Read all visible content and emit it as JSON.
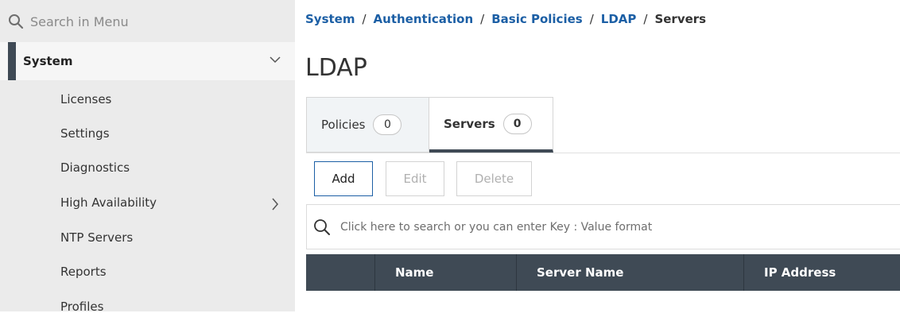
{
  "sidebar": {
    "search_placeholder": "Search in Menu",
    "section_label": "System",
    "items": [
      {
        "label": "Licenses"
      },
      {
        "label": "Settings"
      },
      {
        "label": "Diagnostics"
      },
      {
        "label": "High Availability",
        "has_submenu": true
      },
      {
        "label": "NTP Servers"
      },
      {
        "label": "Reports"
      },
      {
        "label": "Profiles"
      }
    ]
  },
  "breadcrumb": {
    "items": [
      "System",
      "Authentication",
      "Basic Policies",
      "LDAP"
    ],
    "current": "Servers",
    "separator": "/"
  },
  "page": {
    "title": "LDAP"
  },
  "tabs": [
    {
      "label": "Policies",
      "count": "0",
      "active": false
    },
    {
      "label": "Servers",
      "count": "0",
      "active": true
    }
  ],
  "toolbar": {
    "add_label": "Add",
    "edit_label": "Edit",
    "delete_label": "Delete"
  },
  "table": {
    "search_placeholder": "Click here to search or you can enter Key : Value format",
    "columns": [
      "Name",
      "Server Name",
      "IP Address"
    ]
  },
  "colors": {
    "accent": "#1c5fa5",
    "header_bg": "#3f4a55",
    "sidebar_bg": "#ebebeb"
  },
  "icons": {
    "search": "search-icon",
    "chevron_down": "chevron-down-icon",
    "chevron_right": "chevron-right-icon"
  }
}
